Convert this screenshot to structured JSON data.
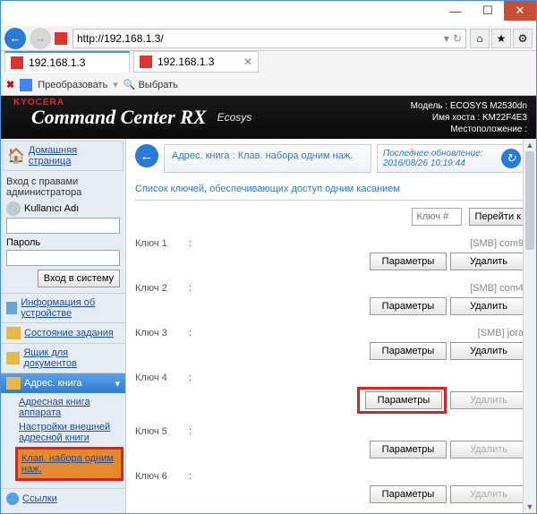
{
  "window": {
    "url": "http://192.168.1.3/",
    "tab_title": "192.168.1.3",
    "tool_convert": "Преобразовать",
    "tool_select": "Выбрать"
  },
  "header": {
    "brand": "KYOCERA",
    "title": "Command Center",
    "title_suffix": "RX",
    "ecosys": "Ecosys",
    "model_label": "Модель :",
    "model_value": "ECOSYS M2530dn",
    "host_label": "Имя хоста :",
    "host_value": "KM22F4E3",
    "location_label": "Местоположение :"
  },
  "sidebar": {
    "home": "Домашняя страница",
    "login_header": "Вход с правами администратора",
    "user_label": "Kullanıcı Adı",
    "pass_label": "Пароль",
    "login_btn": "Вход в систему",
    "items": [
      "Информация об устройстве",
      "Состояние задания",
      "Ящик для документов"
    ],
    "active": "Адрес. книга",
    "sub": [
      "Адресная книга аппарата",
      "Настройки внешней адресной книги",
      "Клав. набора одним наж."
    ],
    "links": "Ссылки"
  },
  "crumb": {
    "text": "Адрес. книга : Клав. набора одним наж.",
    "refresh_label": "Последнее обновление:",
    "refresh_time": "2016/08/26 10:19:44"
  },
  "list": {
    "title": "Список ключей, обеспечивающих доступ одним касанием",
    "key_placeholder": "Ключ #",
    "goto_btn": "Перейти к",
    "params_btn": "Параметры",
    "delete_btn": "Удалить",
    "rows": [
      {
        "n": "1",
        "val": "[SMB] com9",
        "p": true,
        "d": true,
        "hl": false
      },
      {
        "n": "2",
        "val": "[SMB] com4",
        "p": true,
        "d": true,
        "hl": false
      },
      {
        "n": "3",
        "val": "[SMB] jora",
        "p": true,
        "d": true,
        "hl": false
      },
      {
        "n": "4",
        "val": "",
        "p": true,
        "d": false,
        "hl": true
      },
      {
        "n": "5",
        "val": "",
        "p": true,
        "d": false,
        "hl": false
      },
      {
        "n": "6",
        "val": "",
        "p": true,
        "d": false,
        "hl": false
      }
    ],
    "key_label": "Ключ"
  }
}
